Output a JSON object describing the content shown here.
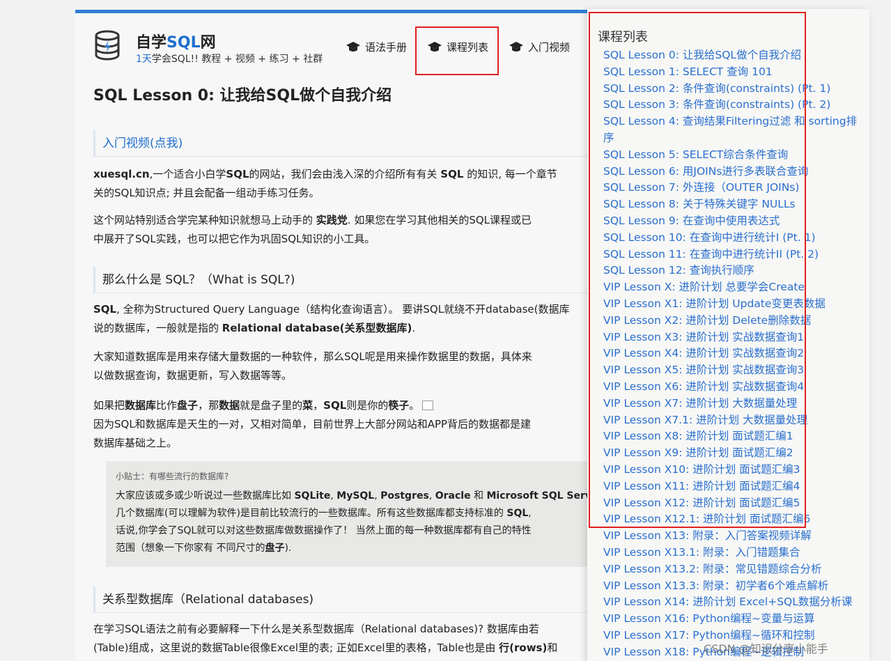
{
  "header": {
    "brand_prefix": "自学",
    "brand_highlight": "SQL",
    "brand_suffix": "网",
    "tagline_highlight": "1天",
    "tagline_rest": "学会SQL!! 教程 + 视频 + 练习 + 社群"
  },
  "nav": {
    "grammar": "语法手册",
    "courses": "课程列表",
    "video": "入门视频"
  },
  "main": {
    "title": "SQL Lesson 0: 让我给SQL做个自我介绍",
    "video_link": "入门视频(点我)",
    "p1_a": "xuesql.cn",
    "p1_b": ",一个适合小白学",
    "p1_c": "SQL",
    "p1_d": "的网站，我们会由浅入深的介绍所有有关 ",
    "p1_e": "SQL",
    "p1_f": " 的知识, 每一个章节",
    "p1_g": "关的SQL知识点; 并且会配备一组动手练习任务。",
    "p2_a": "这个网站特别适合学完某种知识就想马上动手的 ",
    "p2_b": "实践党",
    "p2_c": ". 如果您在学习其他相关的SQL课程或已",
    "p2_d": "中展开了SQL实践，也可以把它作为巩固SQL知识的小工具。",
    "sec_what": "那么什么是 SQL？（What is SQL?)",
    "p3_a": "SQL",
    "p3_b": ", 全称为Structured Query Language（结构化查询语言）。 要讲SQL就绕不开database(数据库",
    "p3_c": "说的数据库，一般就是指的 ",
    "p3_d": "Relational database(关系型数据库)",
    "p3_e": ".",
    "p4_a": "大家知道数据库是用来存储大量数据的一种软件，那么SQL呢是用来操作数据里的数据，具体来",
    "p4_b": "以做数据查询，数据更新，写入数据等等。",
    "p5_a": "如果把",
    "p5_b": "数据库",
    "p5_c": "比作",
    "p5_d": "盘子",
    "p5_e": "，那",
    "p5_f": "数据",
    "p5_g": "就是盘子里的",
    "p5_h": "菜",
    "p5_i": "，",
    "p5_j": "SQL",
    "p5_k": "则是你的",
    "p5_l": "筷子",
    "p5_m": "。",
    "p5_n": "因为SQL和数据库是天生的一对，又相对简单，目前世界上大部分网站和APP背后的数据都是建",
    "p5_o": "数据库基础之上。",
    "tip_title": "小贴士：有哪些流行的数据库?",
    "tip_a": "大家应该或多或少听说过一些数据库比如 ",
    "tip_b": "SQLite",
    "tip_c": ", ",
    "tip_d": "MySQL",
    "tip_e": ", ",
    "tip_f": "Postgres",
    "tip_g": ", ",
    "tip_h": "Oracle",
    "tip_i": " 和 ",
    "tip_j": "Microsoft SQL Serv",
    "tip_k": "几个数据库(可以理解为软件)是目前比较流行的一些数据库。所有这些数据库都支持标准的 ",
    "tip_l": "SQL",
    "tip_m": ",",
    "tip_n": "话说,你学会了SQL就可以对这些数据库做数据操作了！ 当然上面的每一种数据库都有自己的特性",
    "tip_o": "范围（想象一下你家有 不同尺寸的",
    "tip_p": "盘子",
    "tip_q": ").",
    "sec_rel": "关系型数据库（Relational databases)",
    "p6_a": "在学习SQL语法之前有必要解释一下什么是关系型数据库（Relational databases)? 数据库由若",
    "p6_b": "(Table)组成，这里说的数据Table很像Excel里的表; 正如Excel里的表格，Table也是由 ",
    "p6_c": "行(rows)",
    "p6_d": "和"
  },
  "dropdown": {
    "title": "课程列表",
    "items": [
      "SQL Lesson 0: 让我给SQL做个自我介绍",
      "SQL Lesson 1: SELECT 查询 101",
      "SQL Lesson 2: 条件查询(constraints) (Pt. 1)",
      "SQL Lesson 3: 条件查询(constraints) (Pt. 2)",
      "SQL Lesson 4: 查询结果Filtering过滤 和 sorting排序",
      "SQL Lesson 5: SELECT综合条件查询",
      "SQL Lesson 6: 用JOINs进行多表联合查询",
      "SQL Lesson 7: 外连接（OUTER JOINs)",
      "SQL Lesson 8: 关于特殊关键字 NULLs",
      "SQL Lesson 9: 在查询中使用表达式",
      "SQL Lesson 10: 在查询中进行统计I (Pt. 1)",
      "SQL Lesson 11: 在查询中进行统计II (Pt. 2)",
      "SQL Lesson 12: 查询执行顺序",
      "VIP Lesson X: 进阶计划 总要学会Create",
      "VIP Lesson X1: 进阶计划 Update变更表数据",
      "VIP Lesson X2: 进阶计划 Delete删除数据",
      "VIP Lesson X3: 进阶计划 实战数据查询1",
      "VIP Lesson X4: 进阶计划 实战数据查询2",
      "VIP Lesson X5: 进阶计划 实战数据查询3",
      "VIP Lesson X6: 进阶计划 实战数据查询4",
      "VIP Lesson X7: 进阶计划 大数据量处理",
      "VIP Lesson X7.1: 进阶计划 大数据量处理",
      "VIP Lesson X8: 进阶计划 面试题汇编1",
      "VIP Lesson X9: 进阶计划 面试题汇编2",
      "VIP Lesson X10: 进阶计划 面试题汇编3",
      "VIP Lesson X11: 进阶计划 面试题汇编4",
      "VIP Lesson X12: 进阶计划 面试题汇编5",
      "VIP Lesson X12.1: 进阶计划 面试题汇编6",
      "VIP Lesson X13: 附录：入门答案视频详解",
      "VIP Lesson X13.1: 附录：入门错题集合",
      "VIP Lesson X13.2: 附录：常见错题综合分析",
      "VIP Lesson X13.3: 附录：初学者6个难点解析",
      "VIP Lesson X14: 进阶计划 Excel+SQL数据分析课",
      "VIP Lesson X16: Python编程~变量与运算",
      "VIP Lesson X17: Python编程~循环和控制",
      "VIP Lesson X18: Python编程~逻辑控制"
    ]
  },
  "watermark": "CSDN @知识分享小能手",
  "colors": {
    "accent": "#2f7fd6",
    "link": "#2a6fcf",
    "highlight_border": "#e02020"
  }
}
